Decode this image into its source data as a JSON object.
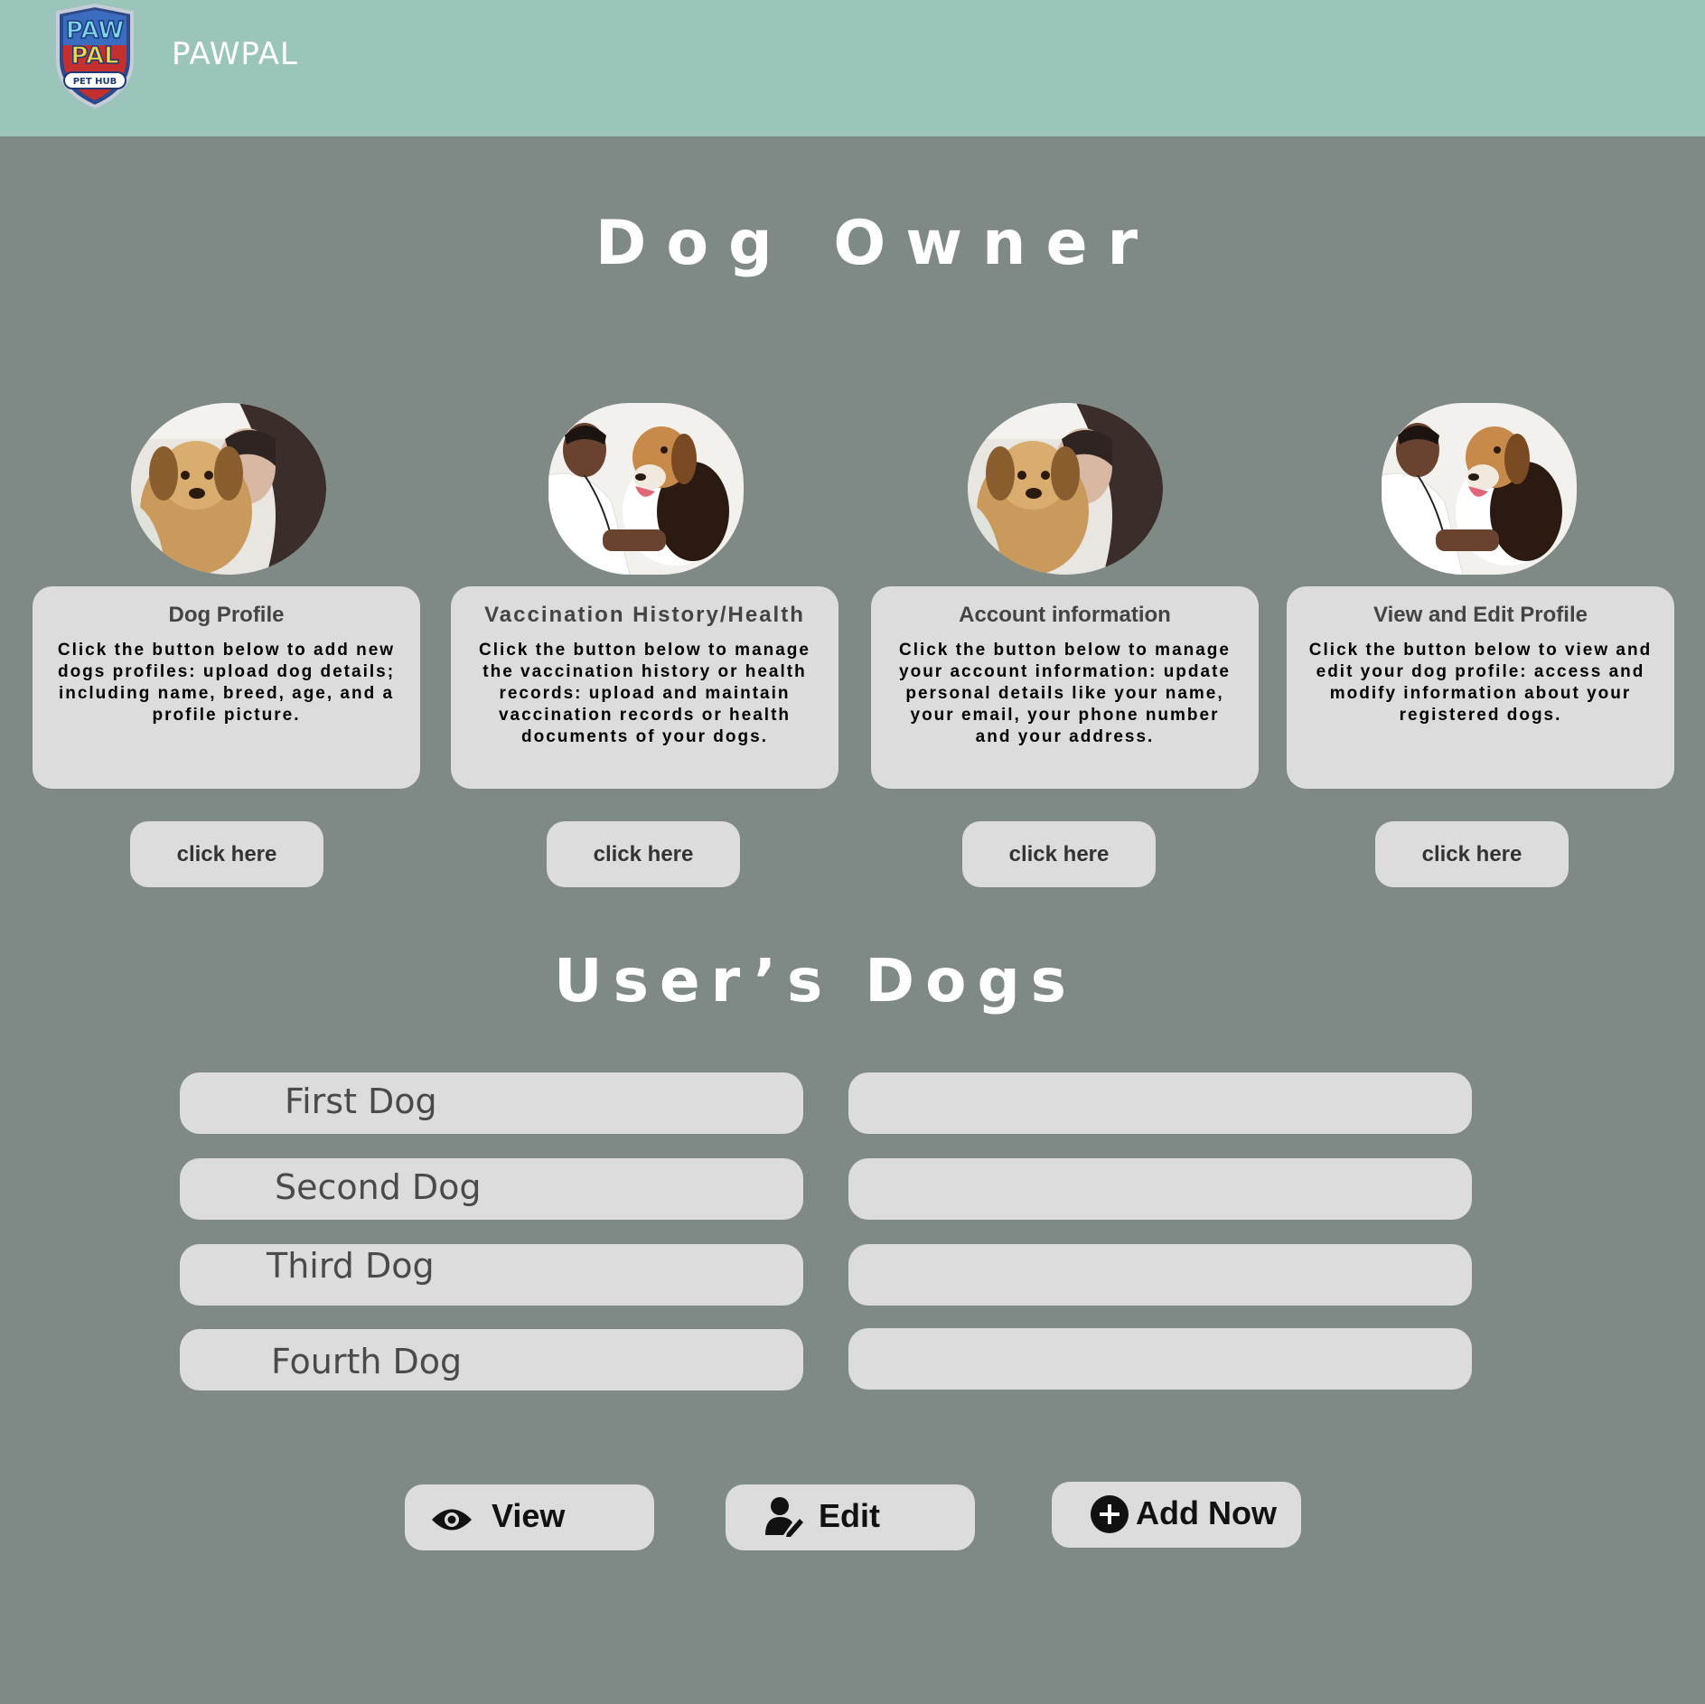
{
  "header": {
    "brand": "PAWPAL",
    "logo": {
      "line1": "PAW",
      "line2": "PAL",
      "badge": "PET HUB"
    }
  },
  "page_title": "Dog Owner",
  "cards": [
    {
      "image": "dog-hugged-by-woman",
      "title": "Dog Profile",
      "description": "Click the button below to add new dogs profiles: upload dog details; including name, breed, age, and a profile picture.",
      "button": "click here"
    },
    {
      "image": "vet-with-beagle",
      "title": "Vaccination History/Health",
      "description": "Click the button below to manage the vaccination history or health records: upload and maintain vaccination records or health documents of your dogs.",
      "button": "click here"
    },
    {
      "image": "dog-hugged-by-woman",
      "title": "Account information",
      "description": "Click the button below to manage your account information: update personal details like your name, your email, your phone number and your address.",
      "button": "click here"
    },
    {
      "image": "vet-with-beagle",
      "title": "View and Edit Profile",
      "description": "Click the button below to view and edit your dog profile: access and modify information about your registered dogs.",
      "button": "click here"
    }
  ],
  "dogs_section": {
    "title": "User’s Dogs",
    "dogs": [
      {
        "label": "First Dog",
        "value": ""
      },
      {
        "label": "Second Dog",
        "value": ""
      },
      {
        "label": "Third Dog",
        "value": ""
      },
      {
        "label": "Fourth Dog",
        "value": ""
      }
    ]
  },
  "actions": {
    "view": {
      "label": "View",
      "icon": "eye-icon"
    },
    "edit": {
      "label": "Edit",
      "icon": "user-edit-icon"
    },
    "add": {
      "label": "Add Now",
      "icon": "plus-circle-icon"
    }
  },
  "colors": {
    "header_bg": "#9bc4bb",
    "page_bg": "#7f8985",
    "card_bg": "#dcdcdc"
  }
}
